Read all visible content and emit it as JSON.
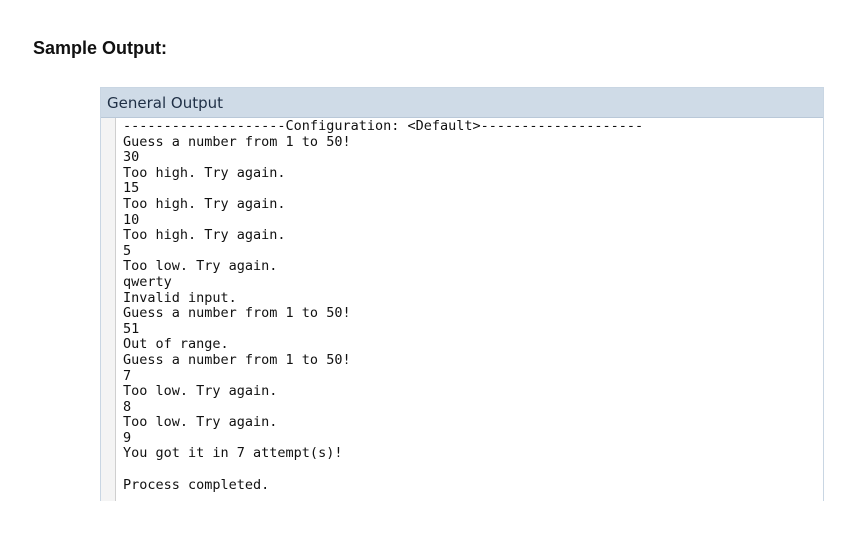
{
  "heading": "Sample Output:",
  "panel": {
    "title": "General Output"
  },
  "console": {
    "lines": [
      "--------------------Configuration: <Default>--------------------",
      "Guess a number from 1 to 50!",
      "30",
      "Too high. Try again.",
      "15",
      "Too high. Try again.",
      "10",
      "Too high. Try again.",
      "5",
      "Too low. Try again.",
      "qwerty",
      "Invalid input.",
      "Guess a number from 1 to 50!",
      "51",
      "Out of range.",
      "Guess a number from 1 to 50!",
      "7",
      "Too low. Try again.",
      "8",
      "Too low. Try again.",
      "9",
      "You got it in 7 attempt(s)!",
      "",
      "Process completed."
    ]
  }
}
